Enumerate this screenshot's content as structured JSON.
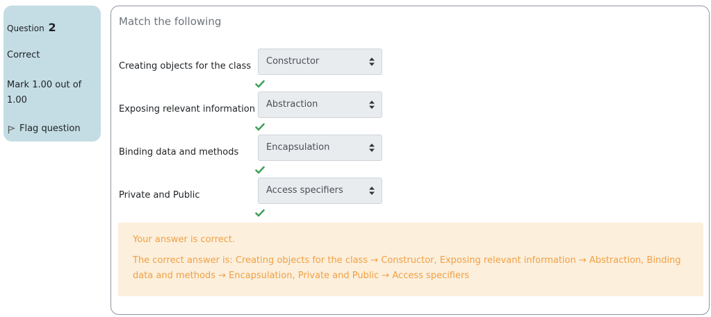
{
  "info": {
    "question_label": "Question",
    "question_number": "2",
    "state": "Correct",
    "grade": "Mark 1.00 out of 1.00",
    "flag_label": "Flag question"
  },
  "question": {
    "text": "Match the following",
    "rows": [
      {
        "label": "Creating objects for the class",
        "selected": "Constructor"
      },
      {
        "label": "Exposing relevant information",
        "selected": "Abstraction"
      },
      {
        "label": "Binding data and methods",
        "selected": "Encapsulation"
      },
      {
        "label": "Private and Public",
        "selected": "Access specifiers"
      }
    ]
  },
  "feedback": {
    "result": "Your answer is correct.",
    "correct_answer": "The correct answer is: Creating objects for the class → Constructor, Exposing relevant information → Abstraction, Binding data and methods → Encapsulation, Private and Public → Access specifiers"
  },
  "colors": {
    "info_bg": "#c4dde4",
    "feedback_bg": "#fcefdc",
    "feedback_text": "#f0a044",
    "check": "#3fa05a"
  }
}
